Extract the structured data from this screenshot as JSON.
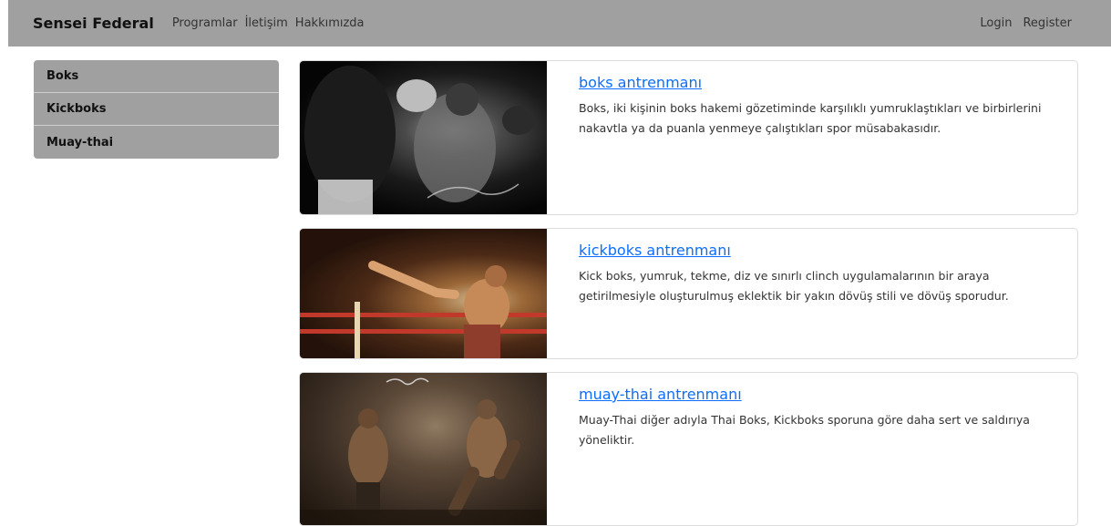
{
  "navbar": {
    "brand": "Sensei Federal",
    "links": [
      "Programlar",
      "İletişim",
      "Hakkımızda"
    ],
    "login": "Login",
    "register": "Register"
  },
  "sidebar": {
    "items": [
      {
        "label": "Boks"
      },
      {
        "label": "Kickboks"
      },
      {
        "label": "Muay-thai"
      }
    ]
  },
  "cards": [
    {
      "title": "boks antrenmanı",
      "text": "Boks, iki kişinin boks hakemi gözetiminde karşılıklı yumruklaştıkları ve birbirlerini nakavtla ya da puanla yenmeye çalıştıkları spor müsabakasıdır.",
      "image": "boxing-photo"
    },
    {
      "title": "kickboks antrenmanı",
      "text": "Kick boks, yumruk, tekme, diz ve sınırlı clinch uygulamalarının bir araya getirilmesiyle oluşturulmuş eklektik bir yakın dövüş stili ve dövüş sporudur.",
      "image": "kickboxing-photo"
    },
    {
      "title": "muay-thai antrenmanı",
      "text": "Muay-Thai diğer adıyla Thai Boks, Kickboks sporuna göre daha sert ve saldırıya yöneliktir.",
      "image": "muay-thai-photo"
    }
  ]
}
